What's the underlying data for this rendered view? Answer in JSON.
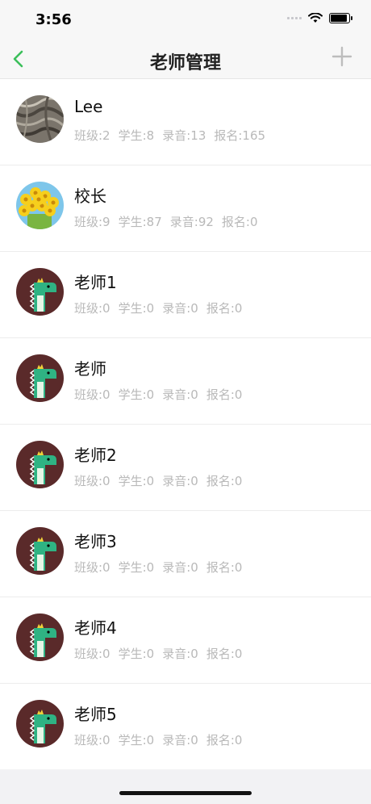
{
  "status": {
    "time": "3:56"
  },
  "nav": {
    "title": "老师管理",
    "back_icon": "chevron-left-icon",
    "add_icon": "plus-icon",
    "accent": "#3bbf5b"
  },
  "teachers": [
    {
      "name": "Lee",
      "avatar": "photo-fur-avatar",
      "stats": {
        "class": "班级:2",
        "students": "学生:8",
        "recordings": "录音:13",
        "enrollments": "报名:165"
      }
    },
    {
      "name": "校长",
      "avatar": "photo-flowers-avatar",
      "stats": {
        "class": "班级:9",
        "students": "学生:87",
        "recordings": "录音:92",
        "enrollments": "报名:0"
      }
    },
    {
      "name": "老师1",
      "avatar": "dinosaur-avatar",
      "stats": {
        "class": "班级:0",
        "students": "学生:0",
        "recordings": "录音:0",
        "enrollments": "报名:0"
      }
    },
    {
      "name": "老师",
      "avatar": "dinosaur-avatar",
      "stats": {
        "class": "班级:0",
        "students": "学生:0",
        "recordings": "录音:0",
        "enrollments": "报名:0"
      }
    },
    {
      "name": "老师2",
      "avatar": "dinosaur-avatar",
      "stats": {
        "class": "班级:0",
        "students": "学生:0",
        "recordings": "录音:0",
        "enrollments": "报名:0"
      }
    },
    {
      "name": "老师3",
      "avatar": "dinosaur-avatar",
      "stats": {
        "class": "班级:0",
        "students": "学生:0",
        "recordings": "录音:0",
        "enrollments": "报名:0"
      }
    },
    {
      "name": "老师4",
      "avatar": "dinosaur-avatar",
      "stats": {
        "class": "班级:0",
        "students": "学生:0",
        "recordings": "录音:0",
        "enrollments": "报名:0"
      }
    },
    {
      "name": "老师5",
      "avatar": "dinosaur-avatar",
      "stats": {
        "class": "班级:0",
        "students": "学生:0",
        "recordings": "录音:0",
        "enrollments": "报名:0"
      }
    }
  ]
}
